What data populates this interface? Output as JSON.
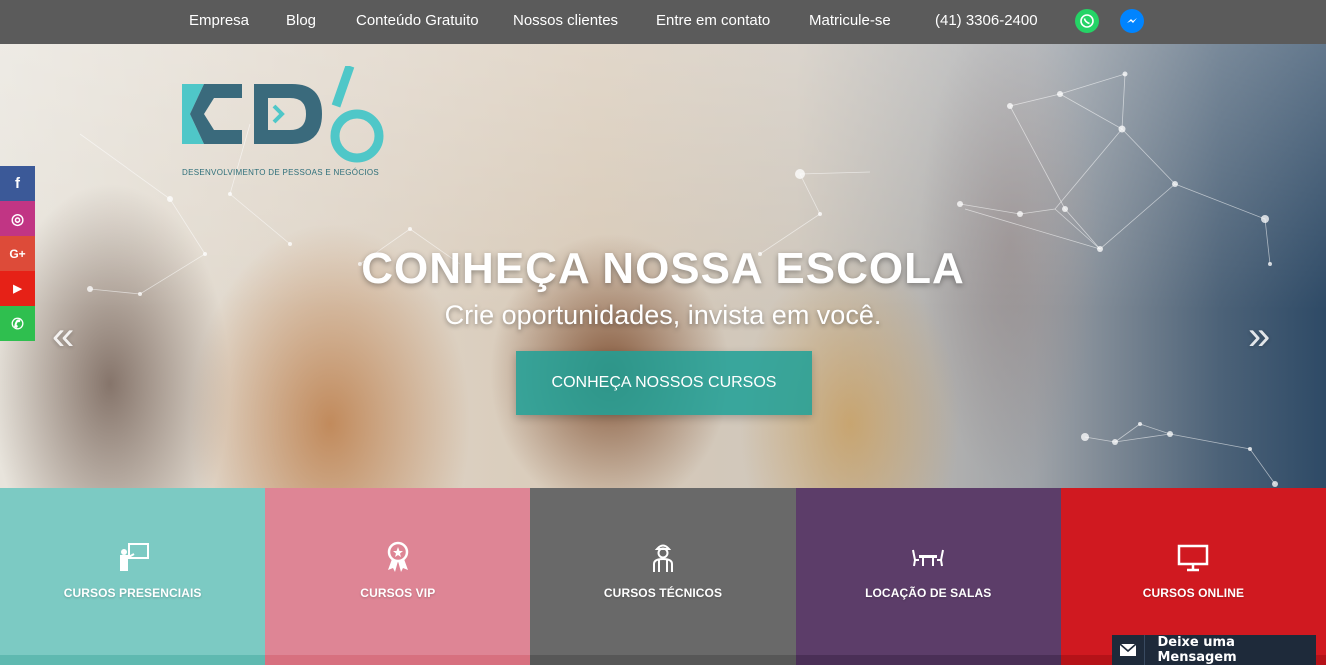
{
  "nav": {
    "items": [
      {
        "label": "Empresa"
      },
      {
        "label": "Blog"
      },
      {
        "label": "Conteúdo Gratuito"
      },
      {
        "label": "Nossos clientes"
      },
      {
        "label": "Entre em contato"
      },
      {
        "label": "Matricule-se"
      }
    ],
    "phone": "(41) 3306-2400",
    "icons": [
      "whatsapp-icon",
      "messenger-icon"
    ],
    "whatsapp_color": "#25d366",
    "messenger_color": "#0084ff"
  },
  "logo": {
    "tagline": "DESENVOLVIMENTO DE PESSOAS E NEGÓCIOS",
    "dark_color": "#3a6a7c",
    "accent_color": "#4fc7c8"
  },
  "hero": {
    "title": "CONHEÇA NOSSA ESCOLA",
    "subtitle": "Crie oportunidades, invista em você.",
    "cta": "CONHEÇA NOSSOS CURSOS",
    "prev_arrow": "«",
    "next_arrow": "»"
  },
  "social": [
    {
      "name": "facebook-icon",
      "glyph": "f",
      "color": "#3b5998"
    },
    {
      "name": "instagram-icon",
      "glyph": "◎",
      "color": "#c13584"
    },
    {
      "name": "google-plus-icon",
      "glyph": "G+",
      "color": "#dd4b39"
    },
    {
      "name": "youtube-icon",
      "glyph": "▶",
      "color": "#e62117"
    },
    {
      "name": "whatsapp-icon",
      "glyph": "✆",
      "color": "#2fbf4f"
    }
  ],
  "tiles": [
    {
      "label": "CURSOS PRESENCIAIS",
      "icon": "presentation-icon",
      "color": "#7fd3cb"
    },
    {
      "label": "CURSOS VIP",
      "icon": "award-icon",
      "color": "#e8899a"
    },
    {
      "label": "CURSOS TÉCNICOS",
      "icon": "worker-icon",
      "color": "#6b6b6b"
    },
    {
      "label": "LOCAÇÃO DE SALAS",
      "icon": "meeting-table-icon",
      "color": "#5d3b6a"
    },
    {
      "label": "CURSOS ONLINE",
      "icon": "monitor-icon",
      "color": "#d7161d"
    }
  ],
  "message_widget": {
    "label": "Deixe uma Mensagem",
    "icon": "envelope-icon"
  }
}
